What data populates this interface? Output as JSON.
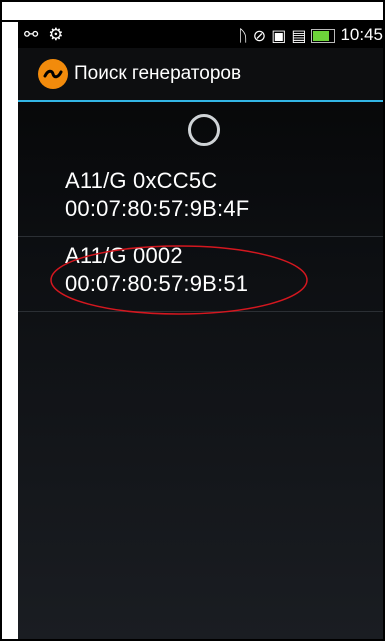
{
  "status_bar": {
    "left_icons": [
      "usb-icon",
      "android-debug-icon"
    ],
    "right_icons": [
      "bluetooth-icon",
      "no-signal-icon",
      "notification-icon",
      "signal-icon",
      "battery-icon"
    ],
    "time": "10:45"
  },
  "action_bar": {
    "app_icon": "tilde-icon",
    "title": "Поиск генераторов"
  },
  "devices": [
    {
      "name": "A11/G 0xCC5C",
      "address": "00:07:80:57:9B:4F"
    },
    {
      "name": "A11/G 0002",
      "address": "00:07:80:57:9B:51",
      "highlighted": true
    }
  ],
  "colors": {
    "accent": "#33b5e5",
    "app_icon": "#f28b0c",
    "highlight_circle": "#d4171f",
    "battery": "#6dd33a"
  }
}
